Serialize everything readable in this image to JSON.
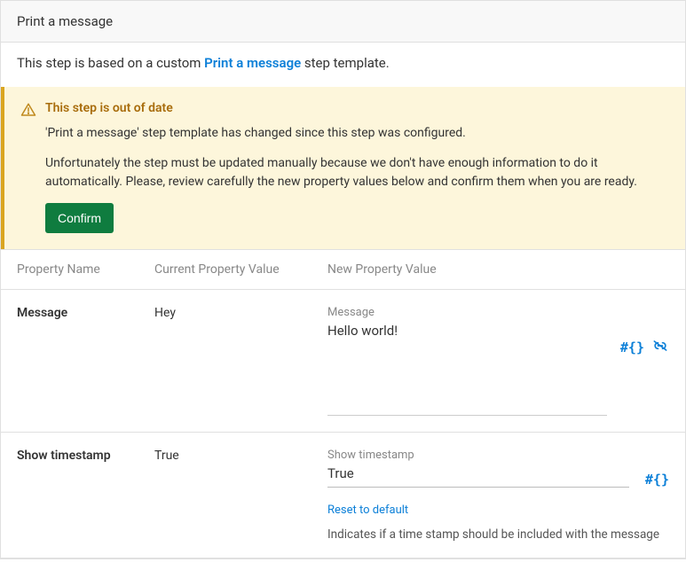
{
  "panel": {
    "title": "Print a message",
    "intro_prefix": "This step is based on a custom ",
    "intro_link": "Print a message",
    "intro_suffix": " step template."
  },
  "alert": {
    "title": "This step is out of date",
    "line1": "'Print a message' step template has changed since this step was configured.",
    "line2": "Unfortunately the step must be updated manually because we don't have enough information to do it automatically. Please, review carefully the new property values below and confirm them when you are ready.",
    "confirm_label": "Confirm"
  },
  "columns": {
    "name": "Property Name",
    "current": "Current Property Value",
    "newv": "New Property Value"
  },
  "rows": [
    {
      "name": "Message",
      "current": "Hey",
      "new_label": "Message",
      "new_value": "Hello world!"
    },
    {
      "name": "Show timestamp",
      "current": "True",
      "new_label": "Show timestamp",
      "new_value": "True",
      "reset_label": "Reset to default",
      "help": "Indicates if a time stamp should be included with the message"
    }
  ],
  "icons": {
    "hash_braces": "#{}"
  }
}
